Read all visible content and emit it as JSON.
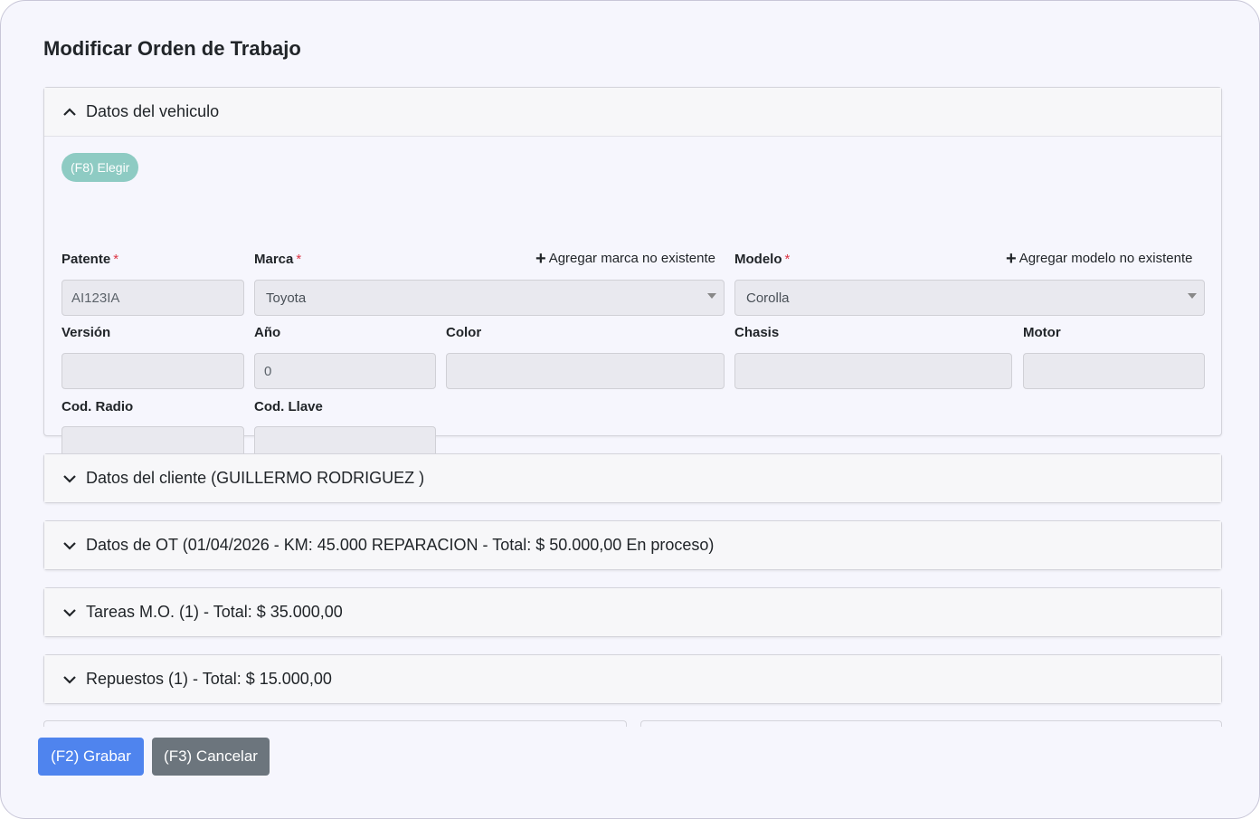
{
  "title": "Modificar Orden de Trabajo",
  "vehicle": {
    "header": "Datos del vehiculo",
    "choose_button": "(F8) Elegir",
    "required_mark": "*",
    "add_brand": "Agregar marca no existente",
    "add_model": "Agregar modelo no existente",
    "labels": {
      "patente": "Patente",
      "marca": "Marca",
      "modelo": "Modelo",
      "version": "Versión",
      "anio": "Año",
      "color": "Color",
      "chasis": "Chasis",
      "motor": "Motor",
      "cod_radio": "Cod. Radio",
      "cod_llave": "Cod. Llave"
    },
    "values": {
      "patente": "AI123IA",
      "marca": "Toyota",
      "modelo": "Corolla",
      "version": "",
      "anio": "0",
      "color": "",
      "chasis": "",
      "motor": "",
      "cod_radio": "",
      "cod_llave": ""
    }
  },
  "sections": {
    "cliente": "Datos del cliente (GUILLERMO RODRIGUEZ )",
    "ot": "Datos de OT (01/04/2026 - KM: 45.000 REPARACION - Total: $ 50.000,00 En proceso)",
    "tareas": "Tareas M.O. (1) - Total: $ 35.000,00",
    "repuestos": "Repuestos (1) - Total: $ 15.000,00"
  },
  "actions": {
    "save": "(F2) Grabar",
    "cancel": "(F3) Cancelar"
  },
  "colors": {
    "primary": "#4f84ee",
    "secondary": "#6c757d",
    "accent_pill": "#8ecbc3",
    "required": "#dc3545"
  }
}
